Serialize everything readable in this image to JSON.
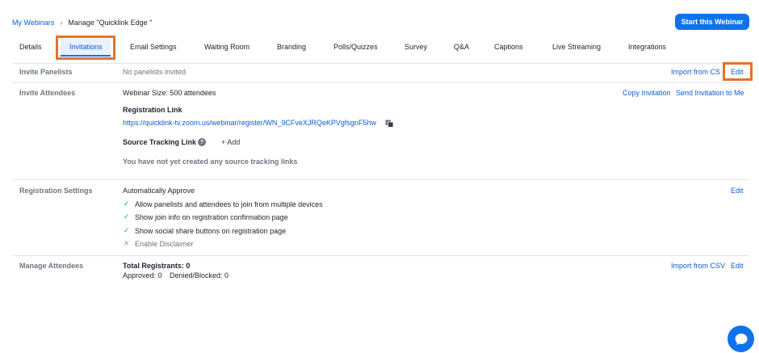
{
  "breadcrumb": {
    "root": "My Webinars",
    "separator": "›",
    "current": "Manage \"Quicklink Edge \""
  },
  "header": {
    "start_button": "Start this Webinar"
  },
  "tabs": [
    {
      "label": "Details"
    },
    {
      "label": "Invitations",
      "active": true
    },
    {
      "label": "Email Settings"
    },
    {
      "label": "Waiting Room"
    },
    {
      "label": "Branding"
    },
    {
      "label": "Polls/Quizzes"
    },
    {
      "label": "Survey"
    },
    {
      "label": "Q&A"
    },
    {
      "label": "Captions"
    },
    {
      "label": "Live Streaming"
    },
    {
      "label": "Integrations"
    }
  ],
  "invite_panelists": {
    "label": "Invite Panelists",
    "status": "No panelists invited",
    "import_link": "Import from CS",
    "edit_link": "Edit"
  },
  "invite_attendees": {
    "label": "Invite Attendees",
    "webinar_size": "Webinar Size: 500 attendees",
    "registration_link_label": "Registration Link",
    "registration_url": "https://quicklink-tv.zoom.us/webinar/register/WN_9CFveXJRQeKPVgfsgnF5hw",
    "source_tracking_label": "Source Tracking Link",
    "help_glyph": "?",
    "add_label": "+  Add",
    "no_tracking_text": "You have not yet created any source tracking links",
    "copy_invitation": "Copy Invitation",
    "send_invitation": "Send Invitation to Me"
  },
  "registration_settings": {
    "label": "Registration Settings",
    "approval": "Automatically Approve",
    "edit_link": "Edit",
    "options": [
      {
        "text": "Allow panelists and attendees to join from multiple devices",
        "glyph": "✓",
        "enabled": true
      },
      {
        "text": "Show join info on registration confirmation page",
        "glyph": "✓",
        "enabled": true
      },
      {
        "text": "Show social share buttons on registration page",
        "glyph": "✓",
        "enabled": true
      },
      {
        "text": "Enable Disclaimer",
        "glyph": "✕",
        "enabled": false
      }
    ]
  },
  "manage_attendees": {
    "label": "Manage Attendees",
    "total": "Total Registrants: 0",
    "approved": "Approved: 0",
    "denied": "Denied/Blocked: 0",
    "import_link": "Import from CSV",
    "edit_link": "Edit"
  },
  "colors": {
    "primary": "#0e72ed",
    "link": "#0e5bd4",
    "highlight": "#e2732b",
    "check_on": "#1ca96a",
    "check_off": "#9aa0a6"
  },
  "icons": {
    "copy": "copy-icon",
    "help": "help-icon",
    "chat": "chat-icon"
  }
}
